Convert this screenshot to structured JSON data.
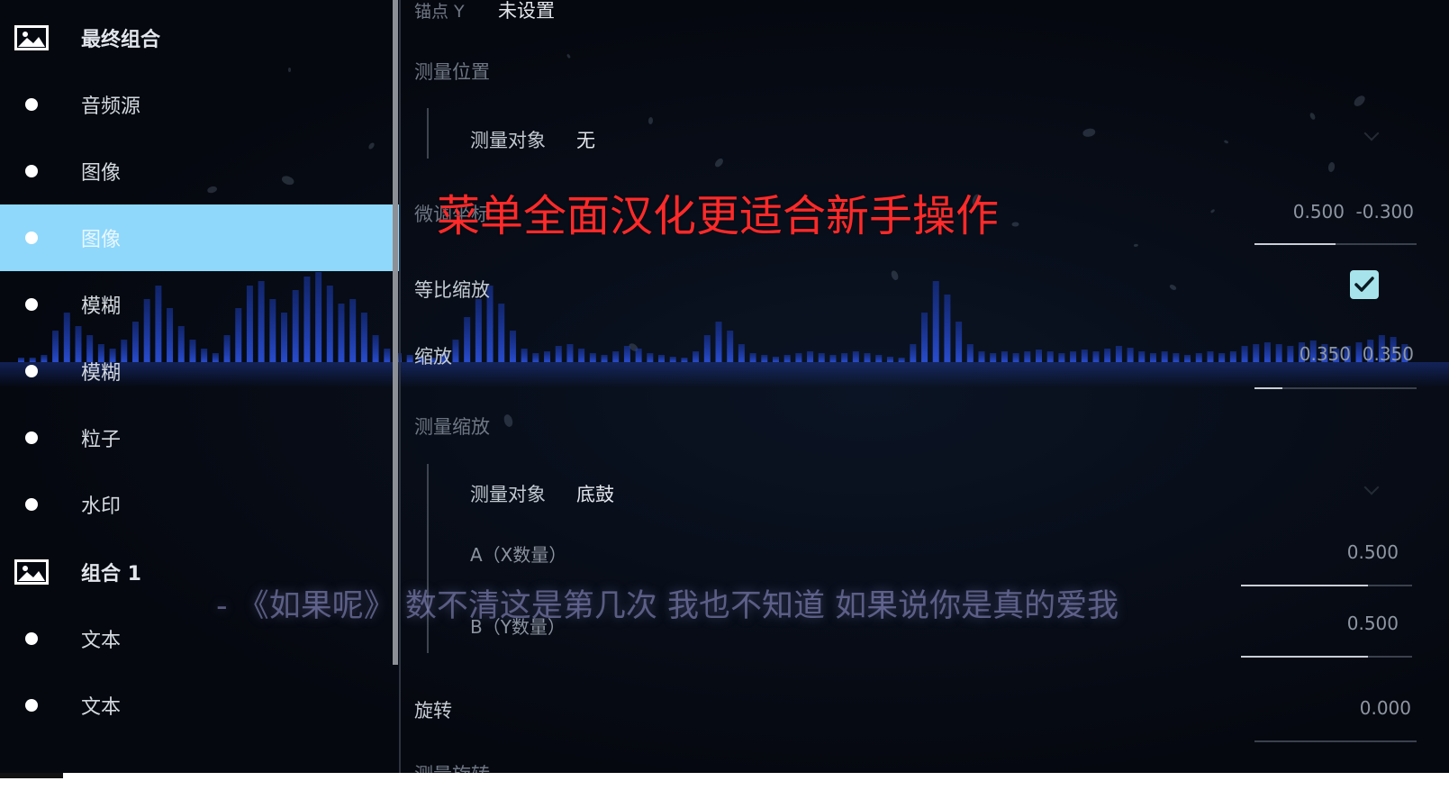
{
  "sidebar": {
    "items": [
      {
        "label": "最终组合",
        "type": "group",
        "selected": false
      },
      {
        "label": "音频源",
        "type": "layer",
        "selected": false
      },
      {
        "label": "图像",
        "type": "layer",
        "selected": false
      },
      {
        "label": "图像",
        "type": "layer",
        "selected": true
      },
      {
        "label": "模糊",
        "type": "layer",
        "selected": false
      },
      {
        "label": "模糊",
        "type": "layer",
        "selected": false
      },
      {
        "label": "粒子",
        "type": "layer",
        "selected": false
      },
      {
        "label": "水印",
        "type": "layer",
        "selected": false
      },
      {
        "label": "组合 1",
        "type": "group",
        "selected": false
      },
      {
        "label": "文本",
        "type": "layer",
        "selected": false
      },
      {
        "label": "文本",
        "type": "layer",
        "selected": false
      }
    ]
  },
  "props": {
    "anchor_y": {
      "label": "锚点 Y",
      "value": "未设置"
    },
    "measure_position": {
      "label": "测量位置",
      "target_label": "测量对象",
      "target_value": "无"
    },
    "fine_tune": {
      "label": "微调坐标",
      "x": "0.500",
      "y": "-0.300",
      "fill": 0.5
    },
    "proportional_scale": {
      "label": "等比缩放",
      "checked": true
    },
    "scale": {
      "label": "缩放",
      "x": "0.350",
      "y": "0.350",
      "fill": 0.17
    },
    "measure_scale": {
      "label": "测量缩放",
      "target_label": "测量对象",
      "target_value": "底鼓",
      "a_label": "A（X数量）",
      "a_value": "0.500",
      "a_fill": 0.74,
      "b_label": "B（Y数量）",
      "b_value": "0.500",
      "b_fill": 0.74
    },
    "rotation": {
      "label": "旋转",
      "value": "0.000",
      "fill": 0.0
    },
    "rotation_cut": {
      "label": "测量旋转"
    }
  },
  "overlay": {
    "headline": "菜单全面汉化更适合新手操作",
    "lyric": "- 《如果呢》 数不清这是第几次 我也不知道 如果说你是真的爱我"
  },
  "colors": {
    "selected_bg": "#8fd8fb",
    "headline": "#ff2a2a",
    "viz_bar": "#2a4fd6",
    "checkbox": "#a7e3ea"
  },
  "visualizer": {
    "levels": [
      0.05,
      0.05,
      0.08,
      0.35,
      0.55,
      0.4,
      0.3,
      0.2,
      0.15,
      0.25,
      0.45,
      0.7,
      0.85,
      0.6,
      0.4,
      0.25,
      0.15,
      0.1,
      0.3,
      0.6,
      0.85,
      0.9,
      0.7,
      0.55,
      0.8,
      0.95,
      1.0,
      0.85,
      0.65,
      0.7,
      0.55,
      0.3,
      0.15,
      0.1,
      0.08,
      0.06,
      0.05,
      0.1,
      0.25,
      0.5,
      0.7,
      0.85,
      0.65,
      0.35,
      0.15,
      0.1,
      0.12,
      0.18,
      0.2,
      0.15,
      0.1,
      0.08,
      0.12,
      0.18,
      0.15,
      0.1,
      0.08,
      0.06,
      0.05,
      0.12,
      0.3,
      0.45,
      0.35,
      0.2,
      0.1,
      0.08,
      0.06,
      0.08,
      0.1,
      0.12,
      0.1,
      0.08,
      0.1,
      0.12,
      0.1,
      0.08,
      0.06,
      0.05,
      0.2,
      0.55,
      0.9,
      0.75,
      0.45,
      0.2,
      0.12,
      0.1,
      0.12,
      0.1,
      0.12,
      0.14,
      0.12,
      0.1,
      0.12,
      0.14,
      0.12,
      0.15,
      0.18,
      0.16,
      0.12,
      0.1,
      0.12,
      0.1,
      0.08,
      0.1,
      0.12,
      0.1,
      0.12,
      0.18,
      0.2,
      0.22,
      0.2,
      0.18,
      0.22,
      0.24,
      0.2,
      0.15,
      0.18,
      0.22,
      0.25,
      0.3,
      0.28,
      0.2
    ]
  }
}
